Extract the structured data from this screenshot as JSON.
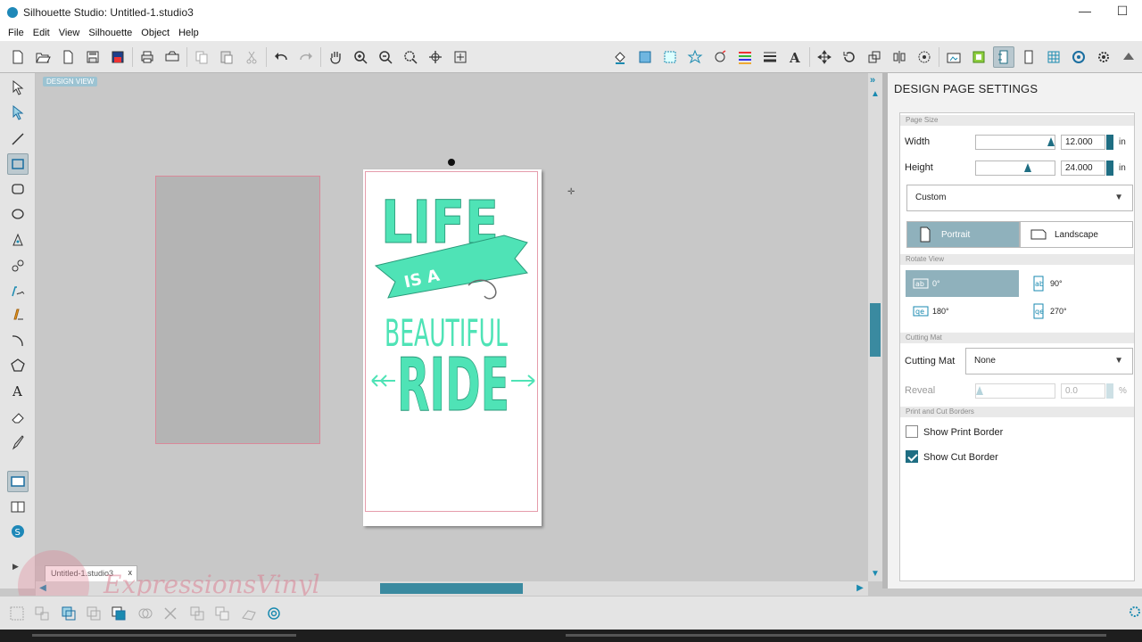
{
  "window": {
    "title": "Silhouette Studio: Untitled-1.studio3",
    "minimize": "—",
    "maximize": "☐"
  },
  "menu": [
    "File",
    "Edit",
    "View",
    "Silhouette",
    "Object",
    "Help"
  ],
  "canvas": {
    "view_label": "DESIGN VIEW"
  },
  "document_tab": {
    "name": "Untitled-1.studio3",
    "close": "x"
  },
  "watermark": {
    "text": "ExpressionsVinyl"
  },
  "design": {
    "line1": "LIFE",
    "banner": "IS A",
    "line3": "BEAUTIFUL",
    "line4": "RIDE",
    "color": "#4fe3b6"
  },
  "panel": {
    "title": "DESIGN PAGE SETTINGS",
    "page_size": {
      "header": "Page Size",
      "width_label": "Width",
      "width_value": "12.000",
      "width_unit": "in",
      "width_level": 0.98,
      "height_label": "Height",
      "height_value": "24.000",
      "height_unit": "in",
      "height_level": 0.66,
      "size_preset": "Custom",
      "orientation": {
        "portrait": "Portrait",
        "landscape": "Landscape",
        "selected": "portrait"
      }
    },
    "rotate_view": {
      "header": "Rotate View",
      "options": [
        "0°",
        "90°",
        "180°",
        "270°"
      ],
      "selected": "0°"
    },
    "cutting_mat": {
      "header": "Cutting Mat",
      "label": "Cutting Mat",
      "value": "None",
      "reveal_label": "Reveal",
      "reveal_value": "0.0",
      "reveal_unit": "%"
    },
    "borders": {
      "header": "Print and Cut Borders",
      "show_print_border": "Show Print Border",
      "print_checked": false,
      "show_cut_border": "Show Cut Border",
      "cut_checked": true
    }
  },
  "colors": {
    "accent": "#1f6e83",
    "selected": "#8fb1bc",
    "cut_line": "#e59cab",
    "scroll": "#3a8aa0"
  }
}
